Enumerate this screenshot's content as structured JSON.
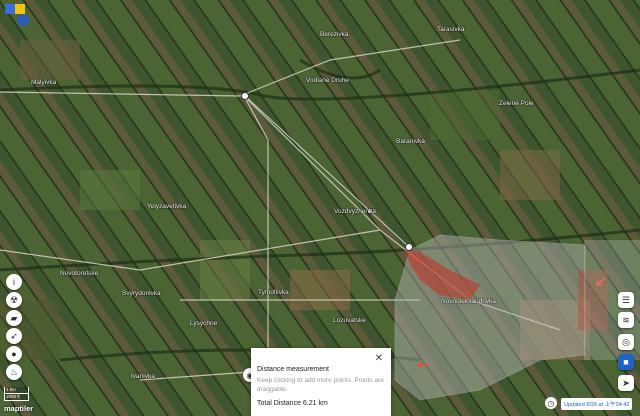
{
  "places": [
    {
      "name": "Malyivka"
    },
    {
      "name": "Berezivka"
    },
    {
      "name": "Tarasivka"
    },
    {
      "name": "Vodiane Druhe"
    },
    {
      "name": "Zelene Pole"
    },
    {
      "name": "Baranivka"
    },
    {
      "name": "Vozdvyzhenka"
    },
    {
      "name": "Yelyzavetivka"
    },
    {
      "name": "Novotoretske"
    },
    {
      "name": "Novooleksandrivka"
    },
    {
      "name": "Svyrydonivka"
    },
    {
      "name": "Tymofiivka"
    },
    {
      "name": "Lysychne"
    },
    {
      "name": "Lozuvatske"
    },
    {
      "name": "Ivanivka"
    }
  ],
  "popup": {
    "title": "Distance measurement",
    "hint": "Keep clicking to add more points. Points are draggable.",
    "total": "Total Distance 6.21 km",
    "close_icon": "close-icon"
  },
  "status": {
    "updated": "Updated 6/26 at 上午04:42"
  },
  "scale": {
    "km": "1 km",
    "ft": "3000 ft"
  },
  "attribution": "maptiler",
  "colors": {
    "occupied": "#c0392b",
    "contested": "#b7b7b7",
    "accent": "#1f63c4"
  },
  "left_tools": [
    "info-icon",
    "radiation-icon",
    "tank-icon",
    "missile-icon",
    "shell-icon",
    "fire-icon"
  ],
  "right_tools": [
    "layers-icon",
    "filter-icon",
    "target-icon",
    "square-icon",
    "navigate-icon"
  ]
}
